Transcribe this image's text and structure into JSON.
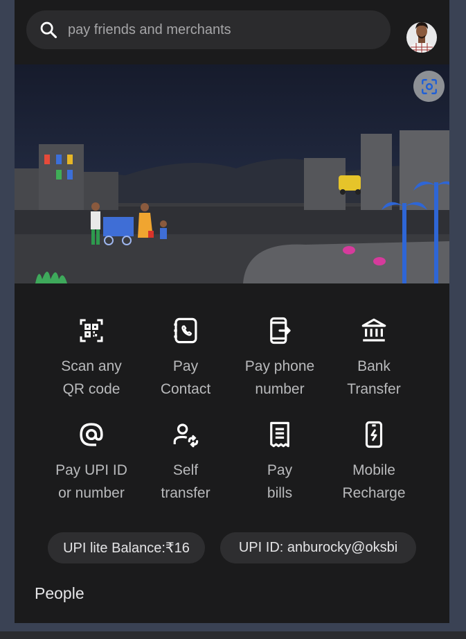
{
  "search": {
    "placeholder": "pay friends and merchants"
  },
  "actions": [
    {
      "line1": "Scan any",
      "line2": "QR code",
      "icon": "qr-scan-icon"
    },
    {
      "line1": "Pay",
      "line2": "Contact",
      "icon": "contact-phone-icon"
    },
    {
      "line1": "Pay phone",
      "line2": "number",
      "icon": "phone-forward-icon"
    },
    {
      "line1": "Bank",
      "line2": "Transfer",
      "icon": "bank-icon"
    },
    {
      "line1": "Pay UPI ID",
      "line2": "or number",
      "icon": "at-sign-icon"
    },
    {
      "line1": "Self",
      "line2": "transfer",
      "icon": "self-transfer-icon"
    },
    {
      "line1": "Pay",
      "line2": "bills",
      "icon": "bill-receipt-icon"
    },
    {
      "line1": "Mobile",
      "line2": "Recharge",
      "icon": "mobile-recharge-icon"
    }
  ],
  "chips": {
    "upi_lite": "UPI lite Balance:₹16",
    "upi_id": "UPI ID: anburocky@oksbi"
  },
  "sections": {
    "people": "People"
  },
  "colors": {
    "background": "#1b1b1c",
    "search_bg": "#2b2b2d",
    "chip_bg": "#2e2e30",
    "text_muted": "#b9babc",
    "outer_bg": "#3a4254"
  }
}
